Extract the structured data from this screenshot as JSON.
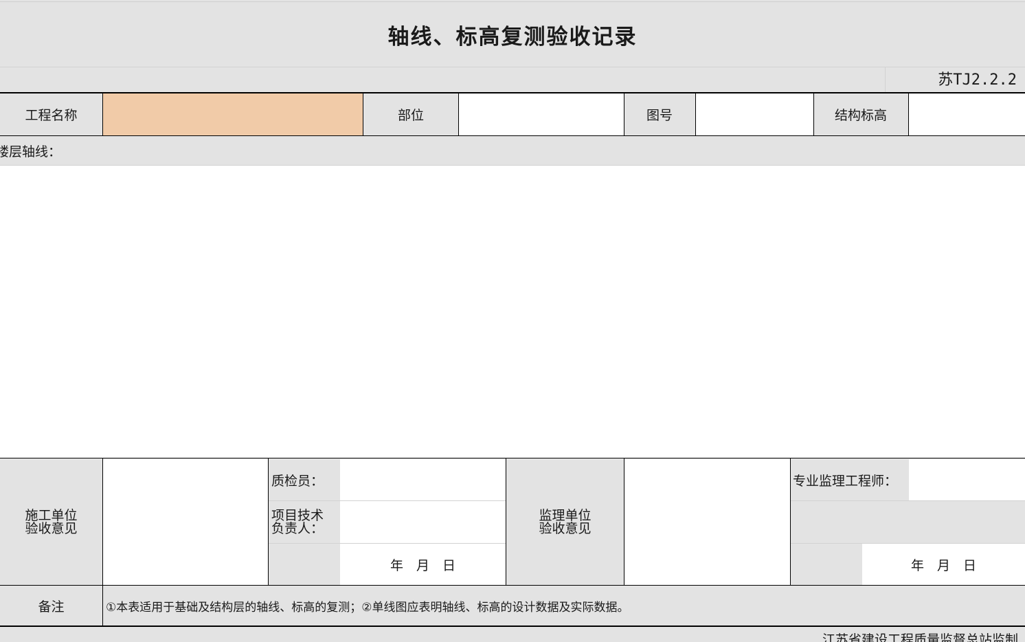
{
  "form": {
    "title": "轴线、标高复测验收记录",
    "code": "苏TJ2.2.2",
    "header": {
      "project_name_label": "工程名称",
      "project_name_value": "",
      "part_label": "部位",
      "part_value": "",
      "drawing_no_label": "图号",
      "drawing_no_value": "",
      "structure_elevation_label": "结构标高",
      "structure_elevation_value": ""
    },
    "floor_axis_label": "楼层轴线：",
    "construction": {
      "label_line1": "施工单位",
      "label_line2": "验收意见",
      "inspector_label": "质检员：",
      "tech_label_line1": "项目技术",
      "tech_label_line2": "负责人：",
      "date_text": "年　月　日"
    },
    "supervision": {
      "label_line1": "监理单位",
      "label_line2": "验收意见",
      "engineer_label": "专业监理工程师：",
      "date_text": "年　月　日"
    },
    "remark_label": "备注",
    "remark_text": "①本表适用于基础及结构层的轴线、标高的复测；②单线图应表明轴线、标高的设计数据及实际数据。",
    "footer": "江苏省建设工程质量监督总站监制"
  },
  "colors": {
    "sheet_bg": "#e3e3e3",
    "input_bg": "#ffffff",
    "highlight_bg": "#f1cba8",
    "border": "#000000"
  }
}
